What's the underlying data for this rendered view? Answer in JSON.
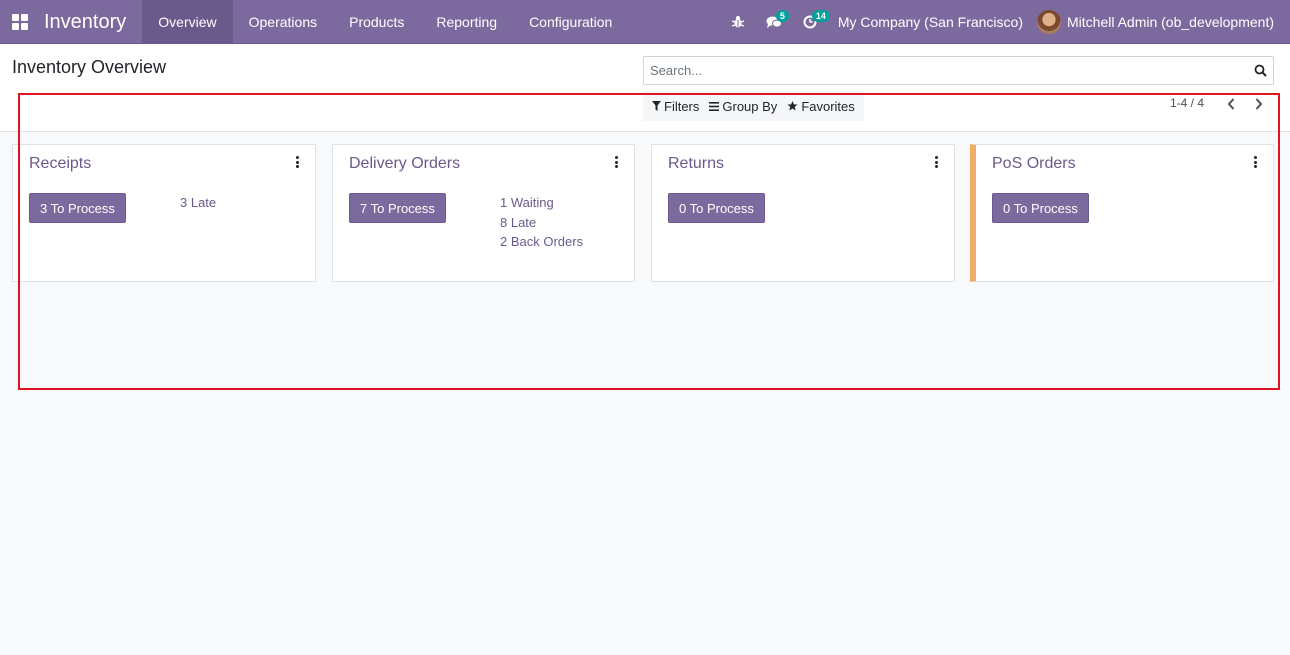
{
  "app": {
    "name": "Inventory",
    "menu": [
      "Overview",
      "Operations",
      "Products",
      "Reporting",
      "Configuration"
    ],
    "active_menu": "Overview"
  },
  "systray": {
    "bug_icon": "bug-icon",
    "messages_count": "5",
    "activities_count": "14",
    "company": "My Company (San Francisco)",
    "user": "Mitchell Admin (ob_development)"
  },
  "control_panel": {
    "title": "Inventory Overview",
    "search_placeholder": "Search...",
    "filters_label": "Filters",
    "groupby_label": "Group By",
    "favorites_label": "Favorites",
    "pager": "1-4 / 4"
  },
  "cards": [
    {
      "title": "Receipts",
      "button": "3 To Process",
      "links": [
        "3 Late"
      ]
    },
    {
      "title": "Delivery Orders",
      "button": "7 To Process",
      "links": [
        "1 Waiting",
        "8 Late",
        "2 Back Orders"
      ]
    },
    {
      "title": "Returns",
      "button": "0 To Process",
      "links": []
    },
    {
      "title": "PoS Orders",
      "button": "0 To Process",
      "links": []
    }
  ],
  "colors": {
    "navbar": "#7c6a9e",
    "accent_stripe": "#f0ad68",
    "highlight": "#e0141e",
    "badge": "#00a09d"
  }
}
